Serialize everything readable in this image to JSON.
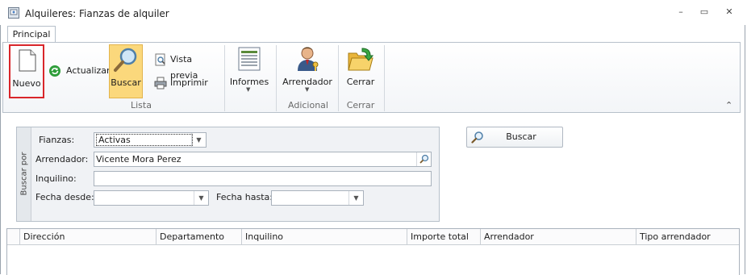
{
  "window": {
    "title": "Alquileres: Fianzas de alquiler"
  },
  "window_controls": {
    "minimize": "–",
    "restore": "▭",
    "close": "✕"
  },
  "ribbon": {
    "tabs": [
      {
        "label": "Principal"
      }
    ],
    "buttons": {
      "nuevo": "Nuevo",
      "actualizar": "Actualizar",
      "buscar": "Buscar",
      "vista_previa": "Vista previa",
      "imprimir": "Imprimir",
      "informes": "Informes",
      "arrendador": "Arrendador",
      "cerrar": "Cerrar"
    },
    "groups": {
      "lista": "Lista",
      "adicional": "Adicional",
      "cerrar": "Cerrar"
    },
    "collapse_glyph": "⌃"
  },
  "search": {
    "section_label": "Buscar por",
    "fianzas_label": "Fianzas:",
    "fianzas_value": "Activas",
    "arrendador_label": "Arrendador:",
    "arrendador_value": "Vicente Mora Perez",
    "inquilino_label": "Inquilino:",
    "inquilino_value": "",
    "fecha_desde_label": "Fecha desde:",
    "fecha_desde_value": "",
    "fecha_hasta_label": "Fecha hasta:",
    "fecha_hasta_value": "",
    "buscar_button": "Buscar"
  },
  "grid": {
    "columns": [
      "Dirección",
      "Departamento",
      "Inquilino",
      "Importe total",
      "Arrendador",
      "Tipo arrendador"
    ]
  },
  "colors": {
    "highlight_border": "#d9262a",
    "active_button": "#fbd87c",
    "accent_blue": "#2f6fbf"
  }
}
